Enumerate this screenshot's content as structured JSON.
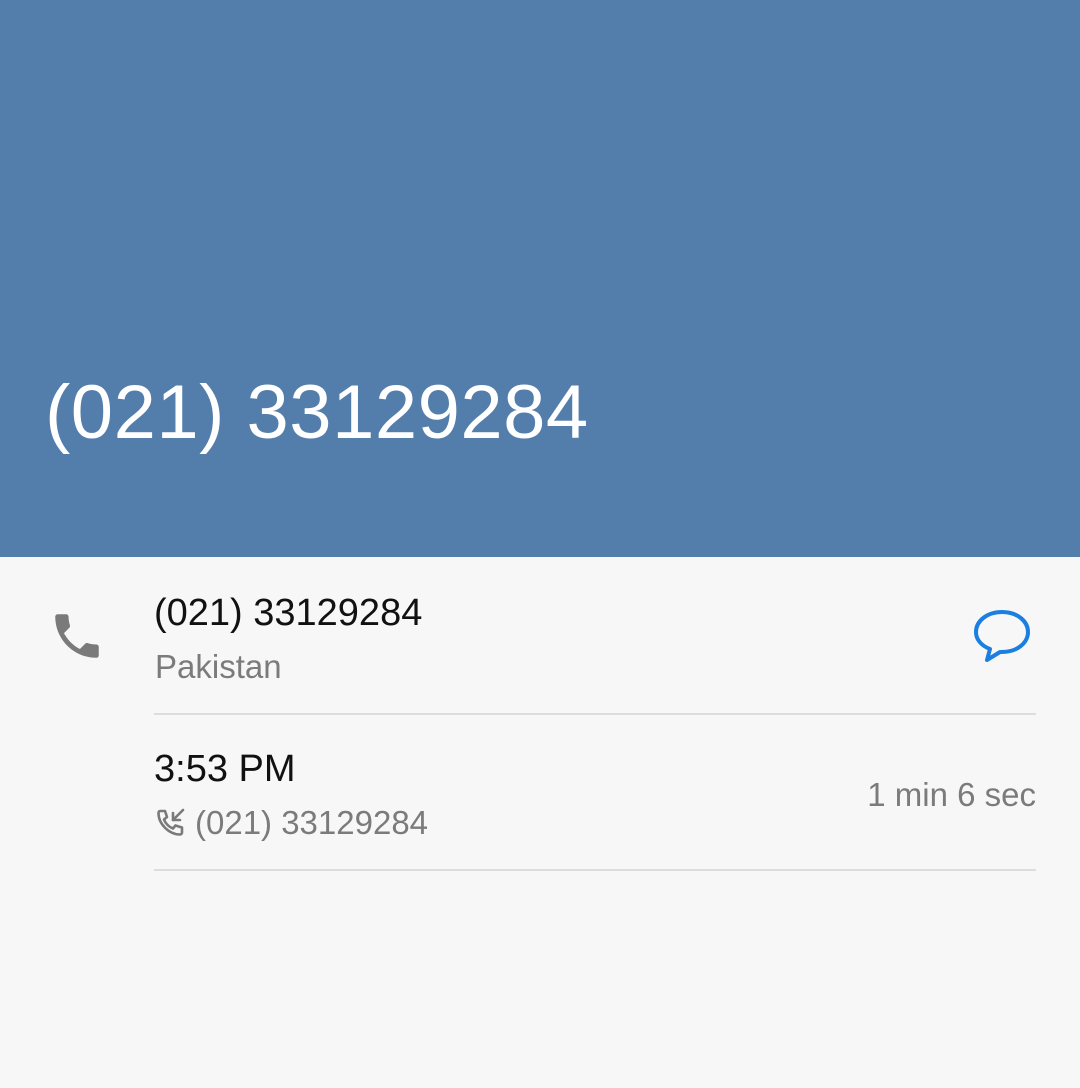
{
  "header": {
    "title": "(021) 33129284",
    "background_color": "#537daa"
  },
  "contact": {
    "number": "(021) 33129284",
    "country": "Pakistan",
    "call_icon": "phone-icon",
    "message_icon": "chat-bubble-icon",
    "accent_color": "#1a7fe0"
  },
  "call_log": [
    {
      "time": "3:53 PM",
      "direction_icon": "incoming-call-icon",
      "number": "(021) 33129284",
      "duration": "1 min 6 sec"
    }
  ]
}
